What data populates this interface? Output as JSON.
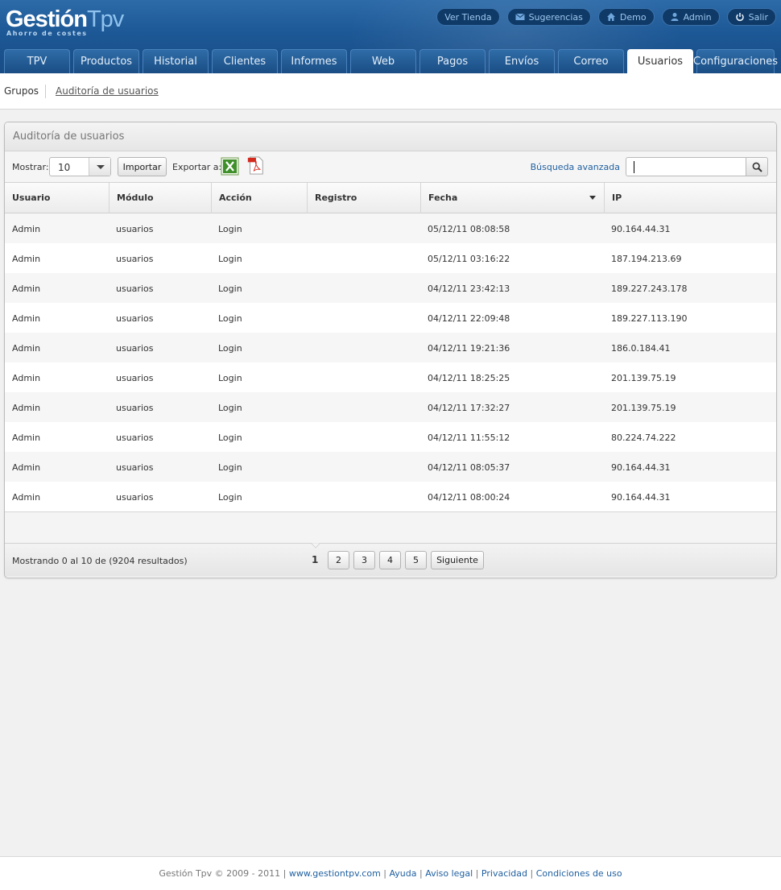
{
  "brand": {
    "name_a": "Gestión",
    "name_b": "Tpv",
    "tagline": "Ahorro de costes"
  },
  "top_links": [
    {
      "label": "Ver Tienda",
      "icon": "none"
    },
    {
      "label": "Sugerencias",
      "icon": "envelope-icon"
    },
    {
      "label": "Demo",
      "icon": "home-icon"
    },
    {
      "label": "Admin",
      "icon": "user-icon"
    },
    {
      "label": "Salir",
      "icon": "power-icon"
    }
  ],
  "tabs": [
    {
      "label": "TPV"
    },
    {
      "label": "Productos"
    },
    {
      "label": "Historial"
    },
    {
      "label": "Clientes"
    },
    {
      "label": "Informes"
    },
    {
      "label": "Web"
    },
    {
      "label": "Pagos"
    },
    {
      "label": "Envíos"
    },
    {
      "label": "Correo"
    },
    {
      "label": "Usuarios",
      "active": true
    },
    {
      "label": "Configuraciones"
    }
  ],
  "subnav": {
    "groups": "Grupos",
    "audit": "Auditoría de usuarios"
  },
  "panel": {
    "title": "Auditoría de usuarios",
    "show_label": "Mostrar:",
    "show_value": "10",
    "import_label": "Importar",
    "export_label": "Exportar a:",
    "advanced_search": "Búsqueda avanzada"
  },
  "table": {
    "headers": [
      "Usuario",
      "Módulo",
      "Acción",
      "Registro",
      "Fecha",
      "IP"
    ],
    "rows": [
      [
        "Admin",
        "usuarios",
        "Login",
        "",
        "05/12/11 08:08:58",
        "90.164.44.31"
      ],
      [
        "Admin",
        "usuarios",
        "Login",
        "",
        "05/12/11 03:16:22",
        "187.194.213.69"
      ],
      [
        "Admin",
        "usuarios",
        "Login",
        "",
        "04/12/11 23:42:13",
        "189.227.243.178"
      ],
      [
        "Admin",
        "usuarios",
        "Login",
        "",
        "04/12/11 22:09:48",
        "189.227.113.190"
      ],
      [
        "Admin",
        "usuarios",
        "Login",
        "",
        "04/12/11 19:21:36",
        "186.0.184.41"
      ],
      [
        "Admin",
        "usuarios",
        "Login",
        "",
        "04/12/11 18:25:25",
        "201.139.75.19"
      ],
      [
        "Admin",
        "usuarios",
        "Login",
        "",
        "04/12/11 17:32:27",
        "201.139.75.19"
      ],
      [
        "Admin",
        "usuarios",
        "Login",
        "",
        "04/12/11 11:55:12",
        "80.224.74.222"
      ],
      [
        "Admin",
        "usuarios",
        "Login",
        "",
        "04/12/11 08:05:37",
        "90.164.44.31"
      ],
      [
        "Admin",
        "usuarios",
        "Login",
        "",
        "04/12/11 08:00:24",
        "90.164.44.31"
      ]
    ]
  },
  "pager": {
    "info": "Mostrando 0 al 10 de (9204 resultados)",
    "current": "1",
    "pages": [
      "2",
      "3",
      "4",
      "5"
    ],
    "next": "Siguiente"
  },
  "footer": {
    "copyright": "Gestión Tpv © 2009 - 2011 |",
    "site": "www.gestiontpv.com",
    "help": "Ayuda",
    "legal": "Aviso legal",
    "privacy": "Privacidad",
    "terms": "Condiciones de uso"
  }
}
